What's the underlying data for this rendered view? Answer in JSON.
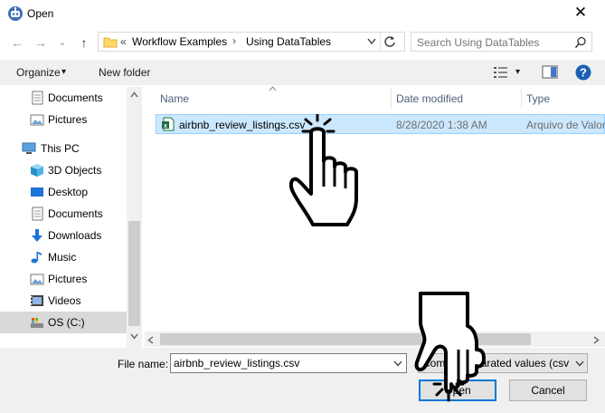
{
  "window": {
    "title": "Open",
    "close": "✕"
  },
  "nav": {
    "back": "←",
    "forward": "→",
    "recent": "⌄",
    "up": "↑"
  },
  "address": {
    "overflow": "«",
    "crumbs": [
      "Workflow Examples",
      "Using DataTables"
    ],
    "separator": "›"
  },
  "search": {
    "placeholder": "Search Using DataTables"
  },
  "toolbar": {
    "organize": "Organize",
    "new_folder": "New folder",
    "dropdown": "▾"
  },
  "sidebar": {
    "items": [
      {
        "label": "Documents",
        "icon": "documents-icon"
      },
      {
        "label": "Pictures",
        "icon": "pictures-icon"
      },
      {
        "label": "This PC",
        "icon": "computer-icon"
      },
      {
        "label": "3D Objects",
        "icon": "3d-objects-icon"
      },
      {
        "label": "Desktop",
        "icon": "desktop-icon"
      },
      {
        "label": "Documents",
        "icon": "documents-icon"
      },
      {
        "label": "Downloads",
        "icon": "downloads-icon"
      },
      {
        "label": "Music",
        "icon": "music-icon"
      },
      {
        "label": "Pictures",
        "icon": "pictures-icon"
      },
      {
        "label": "Videos",
        "icon": "videos-icon"
      },
      {
        "label": "OS (C:)",
        "icon": "drive-icon"
      }
    ]
  },
  "columns": {
    "name": "Name",
    "date": "Date modified",
    "type": "Type"
  },
  "files": [
    {
      "name": "airbnb_review_listings.csv",
      "date": "8/28/2020 1:38 AM",
      "type": "Arquivo de Valores"
    }
  ],
  "footer": {
    "file_name_label": "File name:",
    "file_name_value": "airbnb_review_listings.csv",
    "file_type_value": "Comma separated values (csv f",
    "open": "Open",
    "cancel": "Cancel"
  },
  "colors": {
    "selection": "#cce8ff",
    "accent": "#0078d7",
    "help": "#1a5fb4"
  }
}
